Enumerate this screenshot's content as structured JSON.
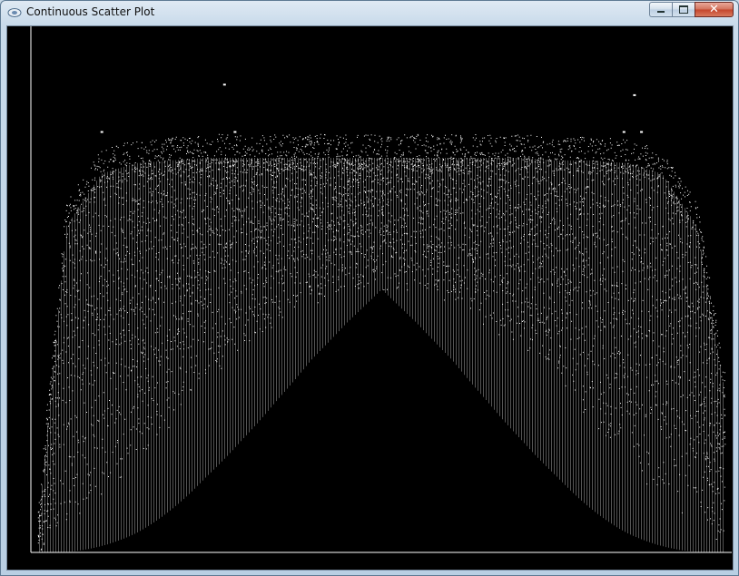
{
  "window": {
    "title": "Continuous Scatter Plot",
    "icon": "app-icon",
    "controls": {
      "minimize": "minimize-icon",
      "maximize": "maximize-icon",
      "close": "close-icon"
    }
  },
  "chart_data": {
    "type": "scatter",
    "title": "",
    "xlabel": "",
    "ylabel": "",
    "grid": false,
    "legend": "none",
    "colors": {
      "background": "#000000",
      "points": "#ffffff",
      "axes": "#ffffff"
    },
    "note_on_values": "",
    "x": [
      -0.98,
      -0.9,
      -0.8,
      -0.7,
      -0.6,
      -0.5,
      -0.4,
      -0.3,
      -0.2,
      -0.1,
      0.0,
      0.1,
      0.2,
      0.3,
      0.4,
      0.5,
      0.6,
      0.7,
      0.8,
      0.9,
      0.98
    ],
    "y_upper": [
      0.05,
      0.62,
      0.72,
      0.74,
      0.745,
      0.75,
      0.75,
      0.75,
      0.75,
      0.75,
      0.75,
      0.75,
      0.75,
      0.75,
      0.75,
      0.745,
      0.745,
      0.74,
      0.72,
      0.62,
      0.3
    ],
    "y_lower": [
      0.0,
      0.05,
      0.1,
      0.16,
      0.24,
      0.32,
      0.38,
      0.43,
      0.47,
      0.49,
      0.5,
      0.49,
      0.47,
      0.43,
      0.38,
      0.32,
      0.24,
      0.16,
      0.1,
      0.05,
      0.0
    ]
  }
}
